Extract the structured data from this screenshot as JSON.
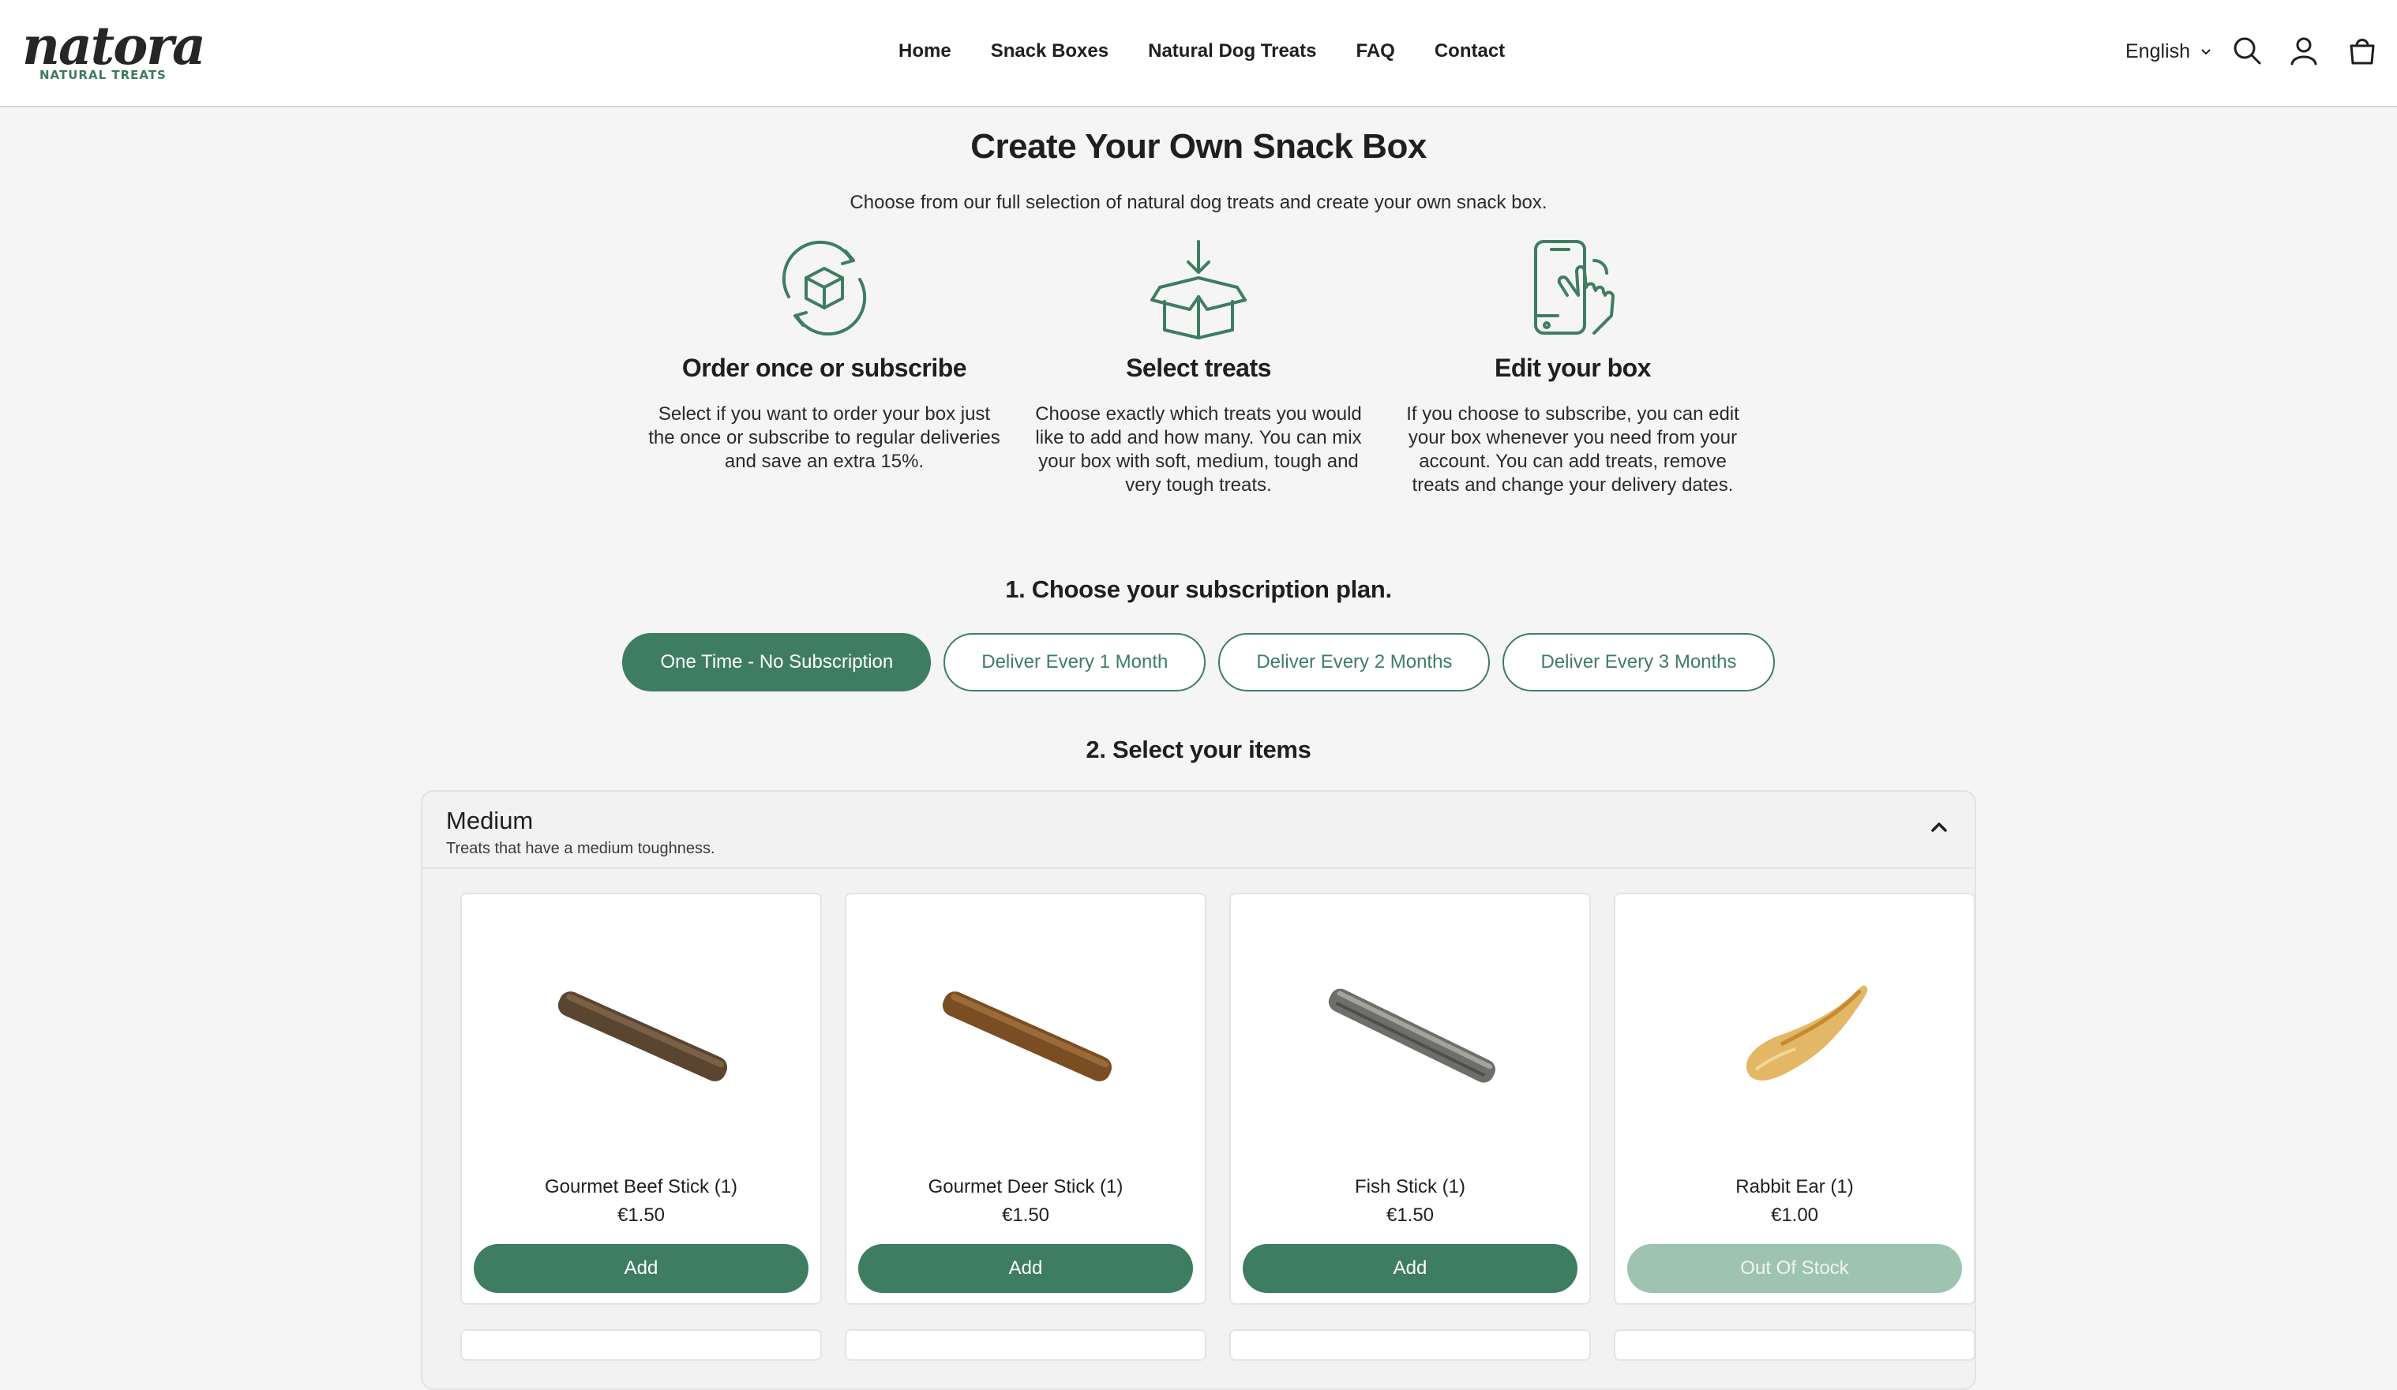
{
  "header": {
    "logo": {
      "word": "natora",
      "sub": "NATURAL TREATS"
    },
    "nav": [
      "Home",
      "Snack Boxes",
      "Natural Dog Treats",
      "FAQ",
      "Contact"
    ],
    "language": "English",
    "icons": [
      "search-icon",
      "account-icon",
      "cart-icon"
    ]
  },
  "intro": {
    "title": "Create Your Own Snack Box",
    "subtitle": "Choose from our full selection of natural dog treats and create your own snack box.",
    "steps": [
      {
        "icon": "box-cycle-icon",
        "title": "Order once or subscribe",
        "text": "Select if you want to order your box just the once or subscribe to regular deliveries and save an extra 15%."
      },
      {
        "icon": "open-box-icon",
        "title": "Select treats",
        "text": "Choose exactly which treats you would like to add and how many. You can mix your box with soft, medium, tough and very tough treats."
      },
      {
        "icon": "phone-tap-icon",
        "title": "Edit your box",
        "text": "If you choose to subscribe, you can edit your box whenever you need from your account. You can add treats, remove treats and change your delivery dates."
      }
    ]
  },
  "plan": {
    "heading": "1. Choose your subscription plan.",
    "options": [
      {
        "label": "One Time - No Subscription",
        "selected": true
      },
      {
        "label": "Deliver Every 1 Month",
        "selected": false
      },
      {
        "label": "Deliver Every 2 Months",
        "selected": false
      },
      {
        "label": "Deliver Every 3 Months",
        "selected": false
      }
    ]
  },
  "items": {
    "heading": "2. Select your items",
    "category": {
      "title": "Medium",
      "description": "Treats that have a medium toughness.",
      "expanded": true,
      "products": [
        {
          "name": "Gourmet Beef Stick (1)",
          "price": "€1.50",
          "action": "Add",
          "in_stock": true
        },
        {
          "name": "Gourmet Deer Stick (1)",
          "price": "€1.50",
          "action": "Add",
          "in_stock": true
        },
        {
          "name": "Fish Stick (1)",
          "price": "€1.50",
          "action": "Add",
          "in_stock": true
        },
        {
          "name": "Rabbit Ear (1)",
          "price": "€1.00",
          "action": "Out Of Stock",
          "in_stock": false
        }
      ]
    }
  },
  "colors": {
    "accent": "#3e7d62",
    "accent_disabled": "#9ec4b1",
    "background": "#f5f5f5"
  }
}
